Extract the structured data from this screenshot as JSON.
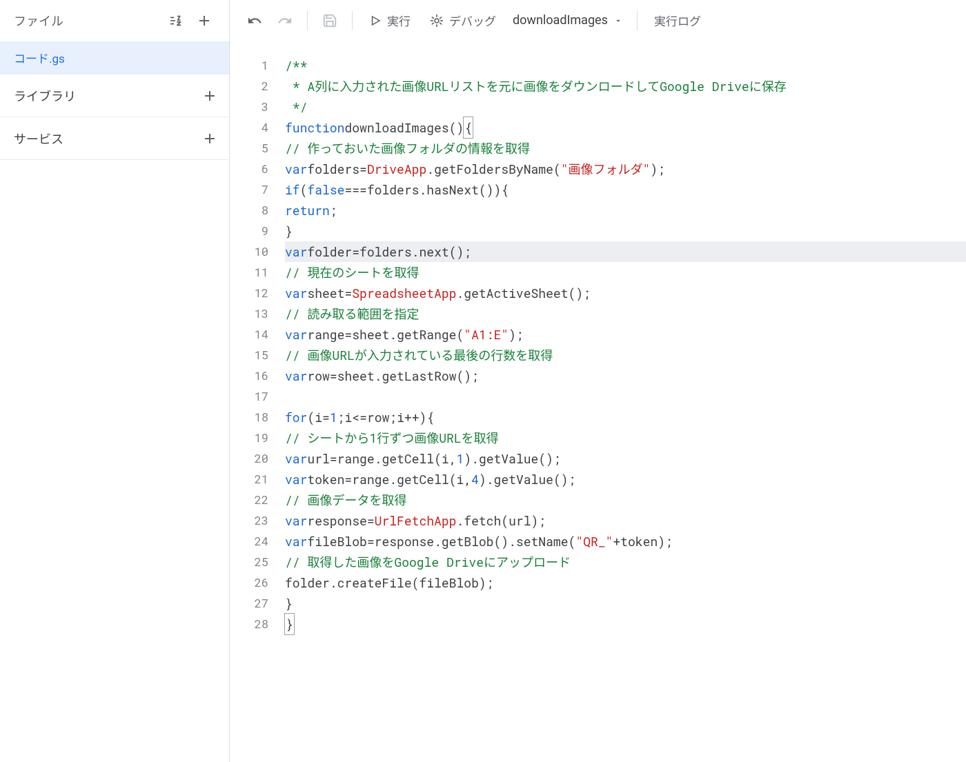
{
  "sidebar": {
    "title": "ファイル",
    "files": [
      {
        "name": "コード.gs",
        "active": true
      }
    ],
    "sections": [
      {
        "label": "ライブラリ"
      },
      {
        "label": "サービス"
      }
    ]
  },
  "toolbar": {
    "run_label": "実行",
    "debug_label": "デバッグ",
    "function_name": "downloadImages",
    "log_label": "実行ログ"
  },
  "code_lines": [
    "/**",
    " * A列に入力された画像URLリストを元に画像をダウンロードしてGoogle Driveに保存",
    " */",
    "function downloadImages() {",
    "  // 作っておいた画像フォルダの情報を取得",
    "  var folders = DriveApp.getFoldersByName(\"画像フォルダ\");",
    "  if(false === folders.hasNext()) {",
    "    return;",
    "  }",
    "  var folder = folders.next();",
    "  // 現在のシートを取得",
    "  var sheet = SpreadsheetApp.getActiveSheet();",
    "  // 読み取る範囲を指定",
    "  var range = sheet.getRange(\"A1:E\");",
    "  // 画像URLが入力されている最後の行数を取得",
    "  var row = sheet.getLastRow();",
    "",
    "  for (i = 1; i <= row; i++) {",
    "    // シートから1行ずつ画像URLを取得",
    "    var url = range.getCell(i,1).getValue();",
    "    var token = range.getCell(i,4).getValue();",
    "    // 画像データを取得",
    "    var response = UrlFetchApp.fetch(url);",
    "    var fileBlob = response.getBlob().setName(\"QR_\" + token);",
    "    // 取得した画像をGoogle Driveにアップロード",
    "    folder.createFile(fileBlob);",
    "  }",
    "}"
  ],
  "highlight_line": 10,
  "line_count": 28
}
